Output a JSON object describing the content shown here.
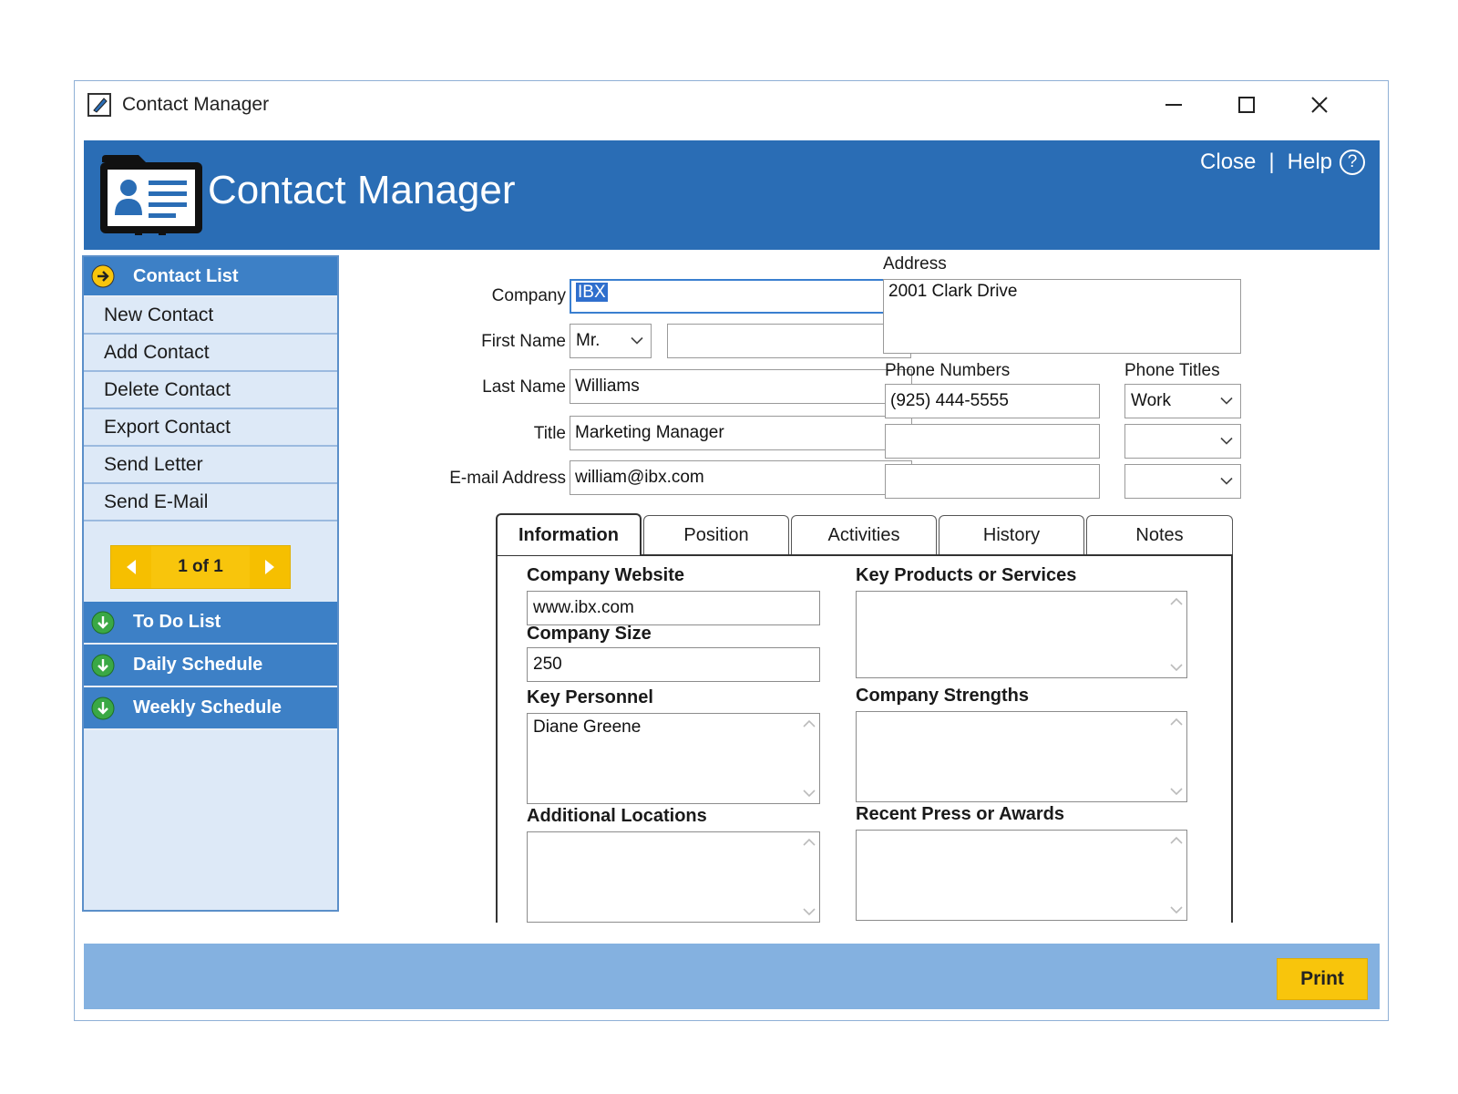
{
  "window": {
    "title": "Contact Manager"
  },
  "banner": {
    "title": "Contact Manager",
    "close_label": "Close",
    "separator": "|",
    "help_label": "Help",
    "help_glyph": "?"
  },
  "sidebar": {
    "header": "Contact List",
    "items": [
      "New Contact",
      "Add Contact",
      "Delete Contact",
      "Export Contact",
      "Send Letter",
      "Send E-Mail"
    ],
    "pager": {
      "text": "1 of 1"
    },
    "sections": [
      "To Do List",
      "Daily Schedule",
      "Weekly Schedule"
    ]
  },
  "form": {
    "company_label": "Company",
    "company_value": "IBX",
    "first_name_label": "First Name",
    "salutation_value": "Mr.",
    "first_name_value": "",
    "last_name_label": "Last Name",
    "last_name_value": "Williams",
    "title_label": "Title",
    "title_value": "Marketing Manager",
    "email_label": "E-mail Address",
    "email_value": "william@ibx.com",
    "address_label": "Address",
    "address_value": "2001 Clark Drive",
    "phone_numbers_label": "Phone Numbers",
    "phone_titles_label": "Phone Titles",
    "phones": [
      {
        "number": "(925) 444-5555",
        "title": "Work"
      },
      {
        "number": "",
        "title": ""
      },
      {
        "number": "",
        "title": ""
      }
    ]
  },
  "tabs": [
    "Information",
    "Position",
    "Activities",
    "History",
    "Notes"
  ],
  "info": {
    "website_label": "Company Website",
    "website_value": "www.ibx.com",
    "size_label": "Company Size",
    "size_value": "250",
    "personnel_label": "Key Personnel",
    "personnel_value": "Diane Greene",
    "locations_label": "Additional Locations",
    "locations_value": "",
    "products_label": "Key Products or Services",
    "products_value": "",
    "strengths_label": "Company Strengths",
    "strengths_value": "",
    "press_label": "Recent Press or Awards",
    "press_value": ""
  },
  "footer": {
    "print_label": "Print"
  },
  "colors": {
    "banner": "#2a6db5",
    "sidebar_section": "#3d80c6",
    "sidebar_bg": "#dde9f7",
    "accent_yellow": "#f8c50c",
    "footer": "#84b1e0"
  }
}
